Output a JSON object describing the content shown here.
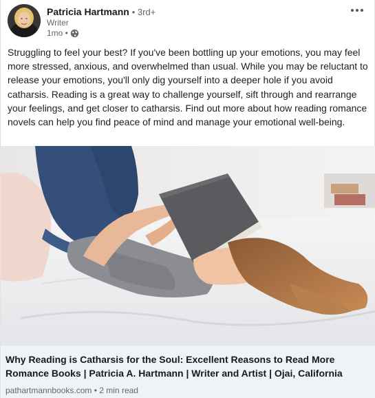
{
  "post": {
    "author": {
      "name": "Patricia Hartmann",
      "degree": "• 3rd+",
      "headline": "Writer",
      "time": "1mo •",
      "visibility_icon": "globe-icon"
    },
    "menu_icon": "more-horizontal-icon",
    "text": "Struggling to feel your best? If you've been bottling up your emotions, you may feel more stressed, anxious, and overwhelmed than usual. While you may be reluctant to release your emotions, you'll only dig yourself into a deeper hole if you avoid catharsis. Reading is a great way to challenge yourself, sift through and rearrange your feelings, and get closer to catharsis. Find out more about how reading romance novels can help you find peace of mind and manage your emotional well-being.",
    "link_preview": {
      "title": "Why Reading is Catharsis for the Soul: Excellent Reasons to Read More Romance Books | Patricia A. Hartmann | Writer and Artist | Ojai, California",
      "meta": "pathartmannbooks.com • 2 min read"
    }
  },
  "colors": {
    "link_bg": "#eef3f8",
    "muted_text": "#666666"
  }
}
